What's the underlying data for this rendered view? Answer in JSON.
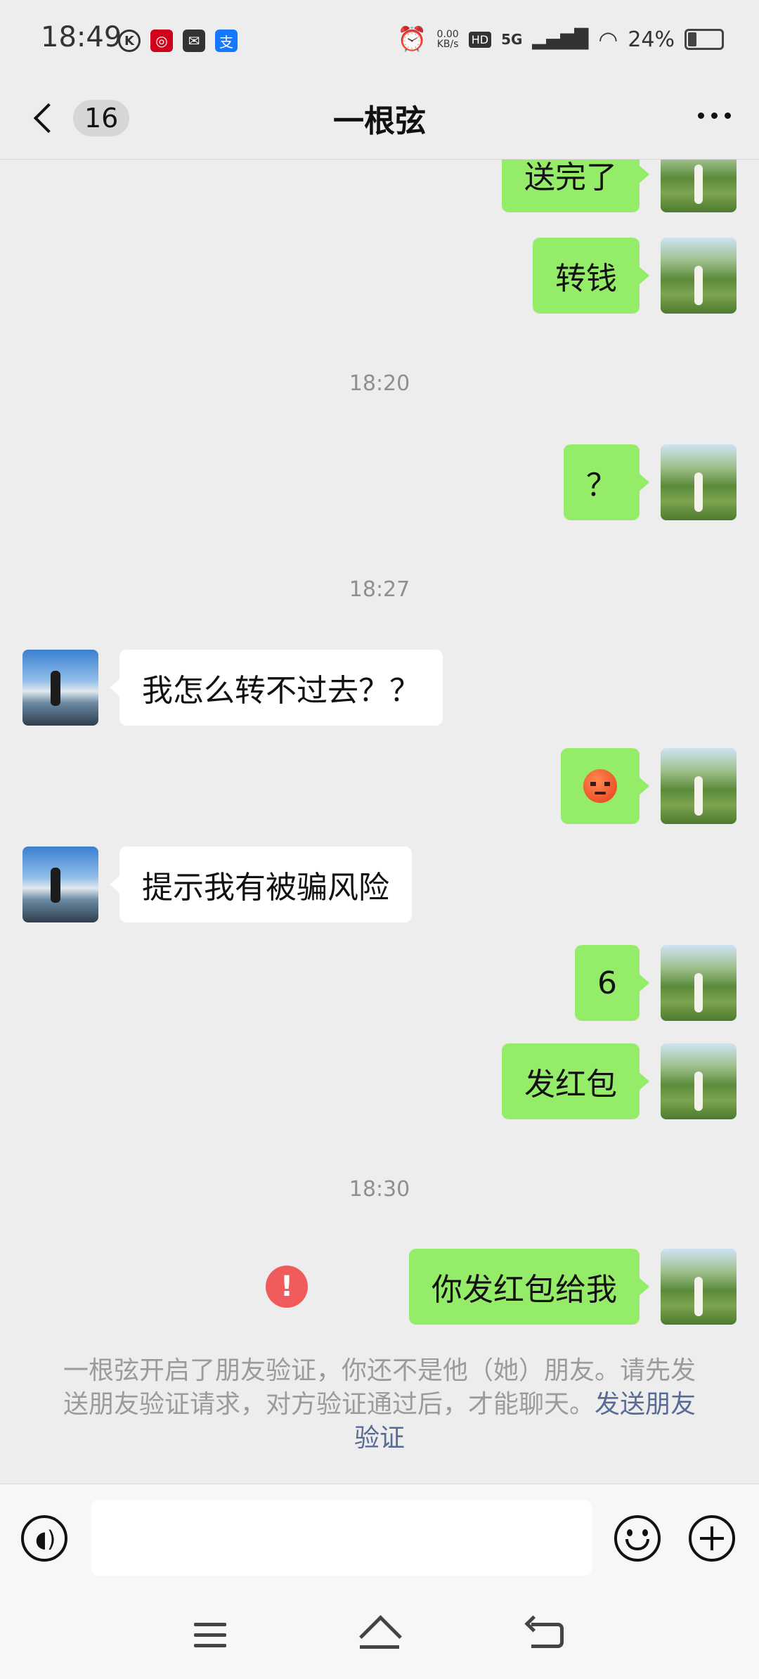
{
  "status_bar": {
    "time": "18:49",
    "left_icons": [
      "k-icon",
      "bank-icon",
      "mail-icon",
      "alipay-icon"
    ],
    "net_speed": "0.00",
    "net_unit": "KB/s",
    "hd": "HD",
    "network": "5G",
    "battery": "24%"
  },
  "nav": {
    "unread_count": "16",
    "title": "一根弦"
  },
  "messages": [
    {
      "type": "me",
      "text": "送完了"
    },
    {
      "type": "me",
      "text": "转钱"
    },
    {
      "type": "time",
      "text": "18:20"
    },
    {
      "type": "me",
      "text": "？"
    },
    {
      "type": "time",
      "text": "18:27"
    },
    {
      "type": "other",
      "text": "我怎么转不过去？？"
    },
    {
      "type": "me",
      "emoji": "angry-face-icon"
    },
    {
      "type": "other",
      "text": "提示我有被骗风险"
    },
    {
      "type": "me",
      "text": "6"
    },
    {
      "type": "me",
      "text": "发红包"
    },
    {
      "type": "time",
      "text": "18:30"
    },
    {
      "type": "me",
      "text": "你发红包给我",
      "failed": true,
      "error_mark": "!"
    }
  ],
  "system_notice": {
    "text": "一根弦开启了朋友验证，你还不是他（她）朋友。请先发送朋友验证请求，对方验证通过后，才能聊天。",
    "link": "发送朋友验证"
  },
  "input": {
    "value": "",
    "placeholder": ""
  },
  "colors": {
    "background": "#ededed",
    "my_bubble": "#95ec69",
    "other_bubble": "#ffffff",
    "link": "#576b95",
    "error": "#f05b5b"
  }
}
